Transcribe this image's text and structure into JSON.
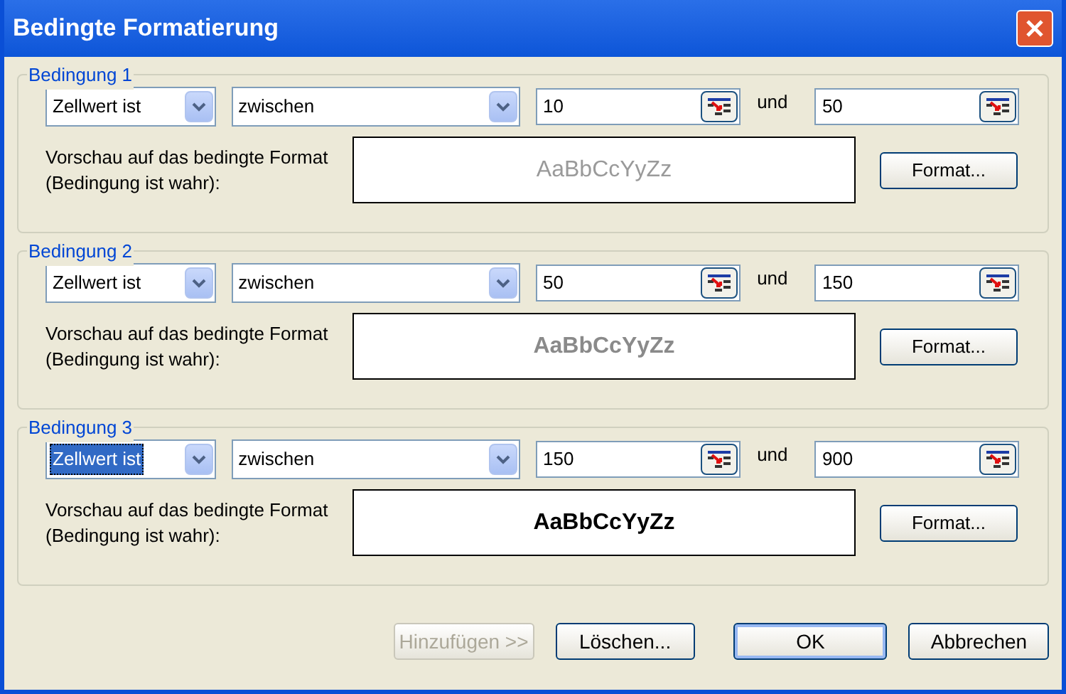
{
  "window": {
    "title": "Bedingte Formatierung"
  },
  "conditions": [
    {
      "legend": "Bedingung 1",
      "operand": {
        "value": "Zellwert ist",
        "focused": false
      },
      "operator": "zwischen",
      "from": "10",
      "joiner": "und",
      "to": "50",
      "preview_label": "Vorschau auf das bedingte Format (Bedingung ist wahr):",
      "preview": {
        "text": "AaBbCcYyZz",
        "kind": "grey"
      },
      "format_button": "Format..."
    },
    {
      "legend": "Bedingung 2",
      "operand": {
        "value": "Zellwert ist",
        "focused": false
      },
      "operator": "zwischen",
      "from": "50",
      "joiner": "und",
      "to": "150",
      "preview_label": "Vorschau auf das bedingte Format (Bedingung ist wahr):",
      "preview": {
        "text": "AaBbCcYyZz",
        "kind": "grey-bold"
      },
      "format_button": "Format..."
    },
    {
      "legend": "Bedingung 3",
      "operand": {
        "value": "Zellwert ist",
        "focused": true
      },
      "operator": "zwischen",
      "from": "150",
      "joiner": "und",
      "to": "900",
      "preview_label": "Vorschau auf das bedingte Format (Bedingung ist wahr):",
      "preview": {
        "text": "AaBbCcYyZz",
        "kind": "bold"
      },
      "format_button": "Format..."
    }
  ],
  "buttons": [
    {
      "label": "Hinzufügen >>",
      "disabled": true,
      "default": false
    },
    {
      "label": "Löschen...",
      "disabled": false,
      "default": false
    },
    {
      "label": "OK",
      "disabled": false,
      "default": true
    },
    {
      "label": "Abbrechen",
      "disabled": false,
      "default": false
    }
  ]
}
